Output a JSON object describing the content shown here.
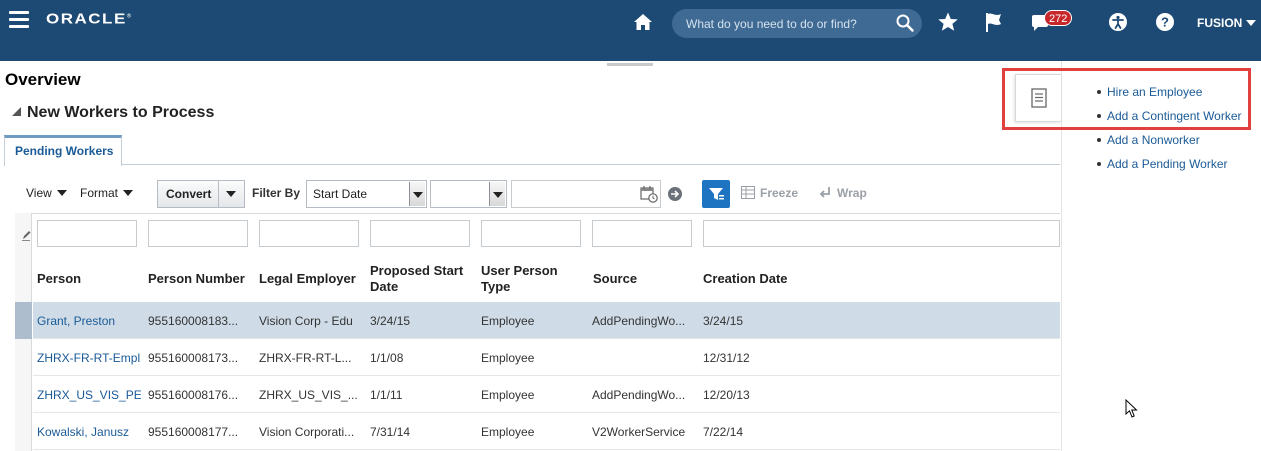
{
  "header": {
    "brand": "ORACLE",
    "brand_mark": "®",
    "search_placeholder": "What do you need to do or find?",
    "notification_count": "272",
    "user": "FUSION",
    "colors": {
      "bar": "#1d4a75",
      "badge": "#c7262b"
    },
    "icons": [
      "hamburger-icon",
      "home-icon",
      "search-icon",
      "star-icon",
      "flag-icon",
      "bell-icon",
      "accessibility-icon",
      "help-icon"
    ]
  },
  "page": {
    "title": "Overview",
    "section": "New Workers to Process",
    "tabs": [
      {
        "label": "Pending Workers",
        "selected": true
      }
    ]
  },
  "toolbar": {
    "view": "View",
    "format": "Format",
    "convert": "Convert",
    "filter_by": "Filter By",
    "filter_field": "Start Date",
    "filter_operator": "",
    "filter_value": "",
    "freeze": "Freeze",
    "wrap": "Wrap"
  },
  "table": {
    "columns": [
      "Person",
      "Person Number",
      "Legal Employer",
      "Proposed Start Date",
      "User Person Type",
      "Source",
      "Creation Date"
    ],
    "rows": [
      {
        "person": "Grant, Preston",
        "number": "955160008183...",
        "employer": "Vision Corp - Edu",
        "start": "3/24/15",
        "type": "Employee",
        "source": "AddPendingWo...",
        "created": "3/24/15",
        "selected": true
      },
      {
        "person": "ZHRX-FR-RT-Empl",
        "number": "955160008173...",
        "employer": "ZHRX-FR-RT-L...",
        "start": "1/1/08",
        "type": "Employee",
        "source": "",
        "created": "12/31/12",
        "selected": false
      },
      {
        "person": "ZHRX_US_VIS_PE",
        "number": "955160008176...",
        "employer": "ZHRX_US_VIS_...",
        "start": "1/1/11",
        "type": "Employee",
        "source": "AddPendingWo...",
        "created": "12/20/13",
        "selected": false
      },
      {
        "person": "Kowalski, Janusz",
        "number": "955160008177...",
        "employer": "Vision Corporati...",
        "start": "7/31/14",
        "type": "Employee",
        "source": "V2WorkerService",
        "created": "7/22/14",
        "selected": false
      }
    ]
  },
  "tasks": {
    "icon": "tasks-icon",
    "items": [
      "Hire an Employee",
      "Add a Contingent Worker",
      "Add a Nonworker",
      "Add a Pending Worker"
    ],
    "highlight_color": "#e0413f"
  }
}
